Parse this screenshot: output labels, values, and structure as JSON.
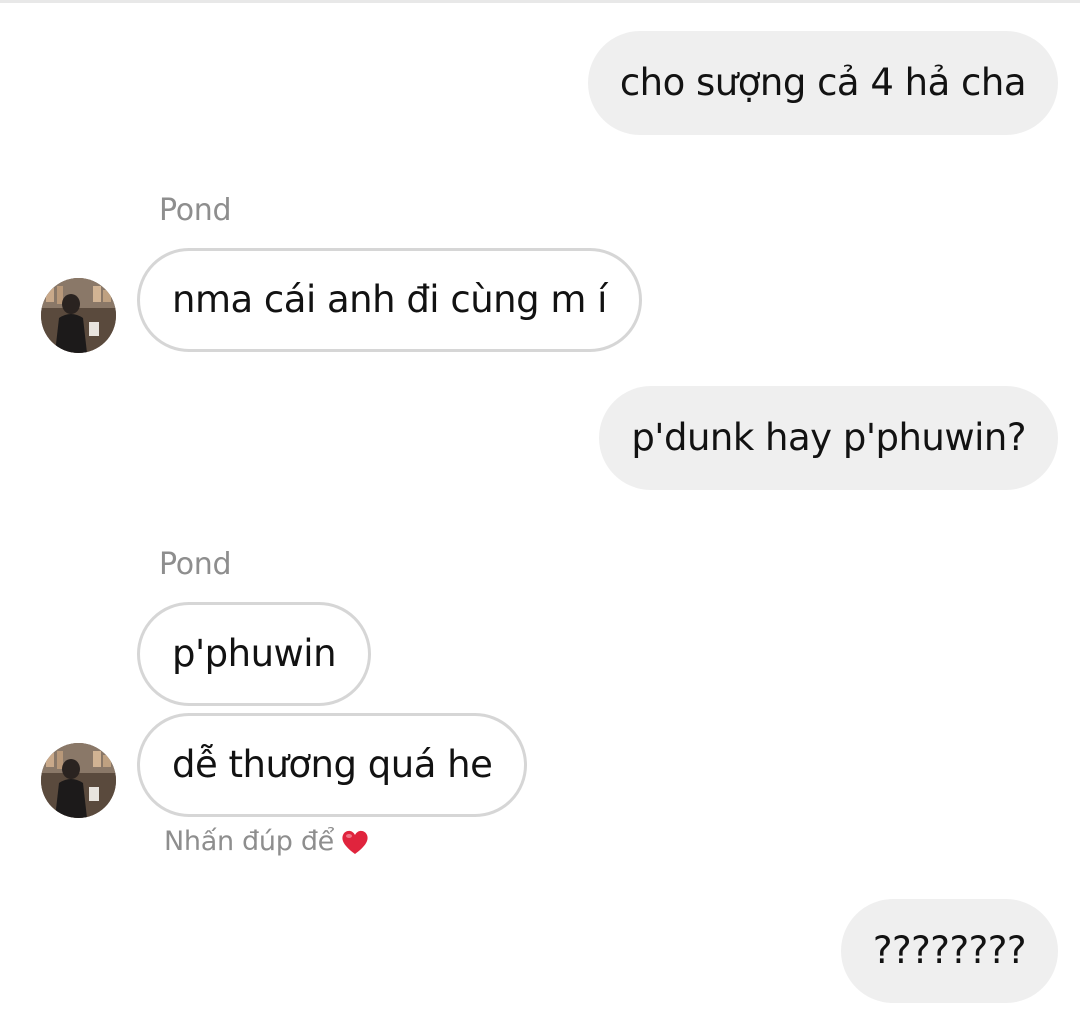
{
  "messages": [
    {
      "text": "cho sượng cả 4 hả cha"
    },
    {
      "sender": "Pond",
      "text": "nma cái anh đi cùng m í"
    },
    {
      "text": "p'dunk hay p'phuwin?"
    },
    {
      "sender": "Pond",
      "text": "p'phuwin"
    },
    {
      "text": "dễ thương quá he"
    },
    {
      "text": "????????"
    }
  ],
  "hint": {
    "text": "Nhấn đúp để",
    "icon": "heart-icon"
  },
  "colors": {
    "out_bubble": "#efefef",
    "in_border": "#d6d6d6",
    "meta_text": "#8e8e8e",
    "heart": "#e0243d"
  }
}
